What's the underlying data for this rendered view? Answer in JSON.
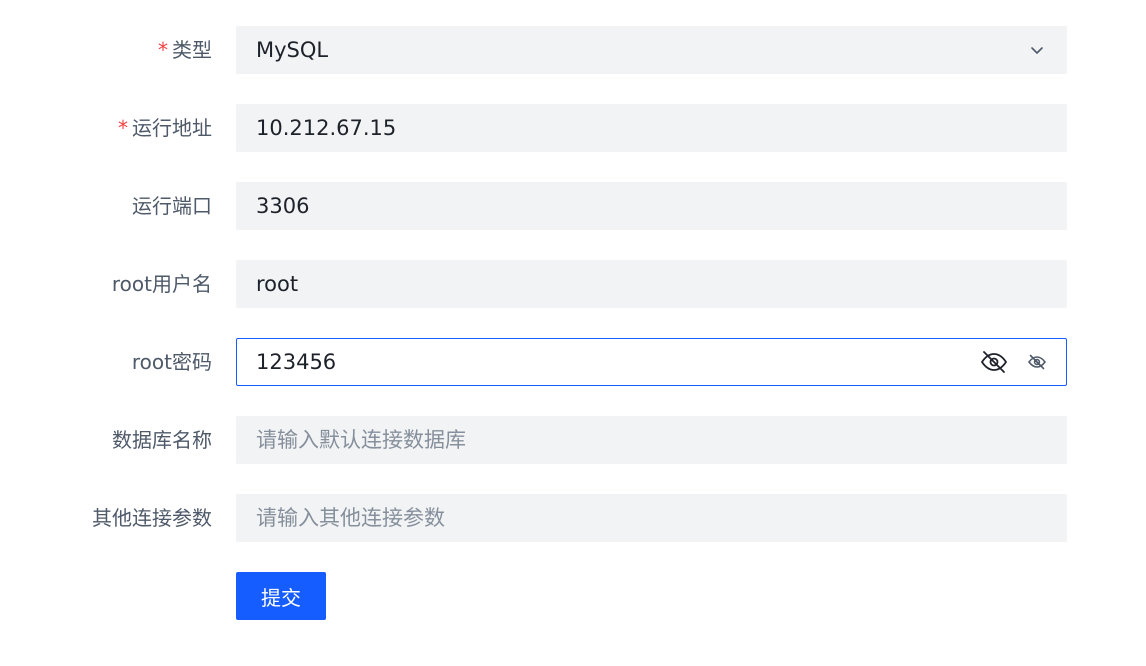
{
  "form": {
    "type": {
      "label": "类型",
      "required_mark": "*",
      "value": "MySQL"
    },
    "host": {
      "label": "运行地址",
      "required_mark": "*",
      "value": "10.212.67.15"
    },
    "port": {
      "label": "运行端口",
      "value": "3306"
    },
    "username": {
      "label": "root用户名",
      "value": "root"
    },
    "password": {
      "label": "root密码",
      "value": "123456"
    },
    "database": {
      "label": "数据库名称",
      "value": "",
      "placeholder": "请输入默认连接数据库"
    },
    "params": {
      "label": "其他连接参数",
      "value": "",
      "placeholder": "请输入其他连接参数"
    },
    "submit_label": "提交"
  },
  "icons": {
    "select": "chevron-down-icon",
    "password_visibility": [
      "eye-off-icon",
      "eye-off-icon"
    ]
  },
  "colors": {
    "primary": "#165dff",
    "required": "#f53f3f",
    "field_bg": "#f2f3f5",
    "label": "#4e5969",
    "text": "#1d2129",
    "placeholder": "#86909c"
  }
}
